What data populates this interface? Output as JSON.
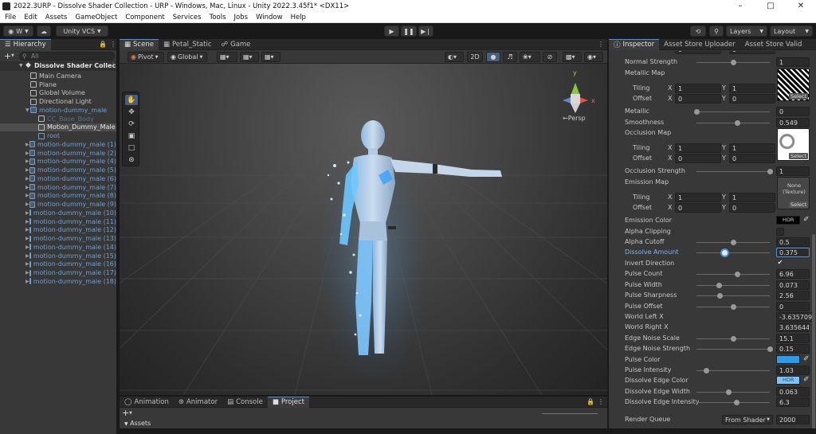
{
  "window": {
    "title": "2022.3URP - Dissolve Shader Collection - URP - Windows, Mac, Linux - Unity 2022.3.45f1* <DX11>"
  },
  "menu": [
    "File",
    "Edit",
    "Assets",
    "GameObject",
    "Component",
    "Services",
    "Tools",
    "Jobs",
    "Window",
    "Help"
  ],
  "toolbar": {
    "account": "W",
    "vcs": "Unity VCS",
    "layers": "Layers",
    "layout": "Layout"
  },
  "hierarchy": {
    "tab": "Hierarchy",
    "search_placeholder": "All",
    "scene": "Dissolve Shader Collec",
    "items": [
      {
        "label": "Main Camera"
      },
      {
        "label": "Plane"
      },
      {
        "label": "Global Volume"
      },
      {
        "label": "Directional Light"
      },
      {
        "label": "motion-dummy_male"
      },
      {
        "label": "CC_Base_Body"
      },
      {
        "label": "Motion_Dummy_Male"
      },
      {
        "label": "root"
      },
      {
        "label": "motion-dummy_male (1)"
      },
      {
        "label": "motion-dummy_male (2)"
      },
      {
        "label": "motion-dummy_male (4)"
      },
      {
        "label": "motion-dummy_male (5)"
      },
      {
        "label": "motion-dummy_male (6)"
      },
      {
        "label": "motion-dummy_male (7)"
      },
      {
        "label": "motion-dummy_male (8)"
      },
      {
        "label": "motion-dummy_male (9)"
      },
      {
        "label": "motion-dummy_male (10)"
      },
      {
        "label": "motion-dummy_male (11)"
      },
      {
        "label": "motion-dummy_male (12)"
      },
      {
        "label": "motion-dummy_male (13)"
      },
      {
        "label": "motion-dummy_male (14)"
      },
      {
        "label": "motion-dummy_male (15)"
      },
      {
        "label": "motion-dummy_male (16)"
      },
      {
        "label": "motion-dummy_male (17)"
      },
      {
        "label": "motion-dummy_male (18)"
      }
    ]
  },
  "scene": {
    "tabs": [
      "Scene",
      "Petal_Static",
      "Game"
    ],
    "pivot": "Pivot",
    "global": "Global",
    "mode_2d": "2D",
    "persp": "←Persp",
    "gizmo_x": "x",
    "gizmo_y": "y"
  },
  "bottom": {
    "tabs": [
      "Animation",
      "Animator",
      "Console",
      "Project"
    ],
    "assets": "Assets"
  },
  "inspector": {
    "tabs": [
      "Inspector",
      "Asset Store Uploader",
      "Asset Store Valid"
    ],
    "top_offset": {
      "label": "Offset",
      "x": "0",
      "y": "0"
    },
    "normal_strength": {
      "label": "Normal Strength",
      "value": "1"
    },
    "metallic_map": {
      "label": "Metallic Map",
      "tiling_label": "Tiling",
      "offset_label": "Offset",
      "tx": "1",
      "ty": "1",
      "ox": "0",
      "oy": "0"
    },
    "metallic": {
      "label": "Metallic",
      "value": "0",
      "level": 0.0
    },
    "smoothness": {
      "label": "Smoothness",
      "value": "0.549",
      "level": 0.549
    },
    "occlusion_map": {
      "label": "Occlusion Map",
      "tiling_label": "Tiling",
      "offset_label": "Offset",
      "tx": "1",
      "ty": "1",
      "ox": "0",
      "oy": "0"
    },
    "occlusion_strength": {
      "label": "Occlusion Strength",
      "value": "1",
      "level": 1.0
    },
    "emission_map": {
      "label": "Emission Map",
      "tiling_label": "Tiling",
      "offset_label": "Offset",
      "tx": "1",
      "ty": "1",
      "ox": "0",
      "oy": "0",
      "texture": "None (Texture)"
    },
    "emission_color": {
      "label": "Emission Color",
      "hdr": "HDR",
      "color": "#000000"
    },
    "alpha_clipping": {
      "label": "Alpha Clipping"
    },
    "alpha_cutoff": {
      "label": "Alpha Cutoff",
      "value": "0.5",
      "level": 0.5
    },
    "dissolve_amount": {
      "label": "Dissolve Amount",
      "value": "0.375",
      "level": 0.375
    },
    "invert_direction": {
      "label": "Invert Direction",
      "checked": "✔"
    },
    "pulse_count": {
      "label": "Pulse Count",
      "value": "6.96"
    },
    "pulse_width": {
      "label": "Pulse Width",
      "value": "0.073"
    },
    "pulse_sharpness": {
      "label": "Pulse Sharpness",
      "value": "2.56"
    },
    "pulse_offset": {
      "label": "Pulse Offset",
      "value": "0"
    },
    "world_left_x": {
      "label": "World Left X",
      "value": "-3.635709"
    },
    "world_right_x": {
      "label": "World Right X",
      "value": "3.635644"
    },
    "edge_noise_scale": {
      "label": "Edge Noise Scale",
      "value": "15.1"
    },
    "edge_noise_strength": {
      "label": "Edge Noise Strength",
      "value": "0.15"
    },
    "pulse_color": {
      "label": "Pulse Color",
      "color": "#2f9be8"
    },
    "pulse_intensity": {
      "label": "Pulse Intensity",
      "value": "1.03"
    },
    "dissolve_edge_color": {
      "label": "Dissolve Edge Color",
      "hdr": "HDR",
      "color": "#7ec2f5"
    },
    "dissolve_edge_width": {
      "label": "Dissolve Edge Width",
      "value": "0.063"
    },
    "dissolve_edge_intensity": {
      "label": "Dissolve Edge Intensity",
      "value": "6.3"
    },
    "render_queue": {
      "label": "Render Queue",
      "source": "From Shader",
      "value": "2000"
    },
    "select_label": "Select"
  },
  "colors": {
    "accent": "#4d8fd8",
    "hierarchy_blue": "#6d9fd8",
    "glow": "#6ec8ff"
  }
}
